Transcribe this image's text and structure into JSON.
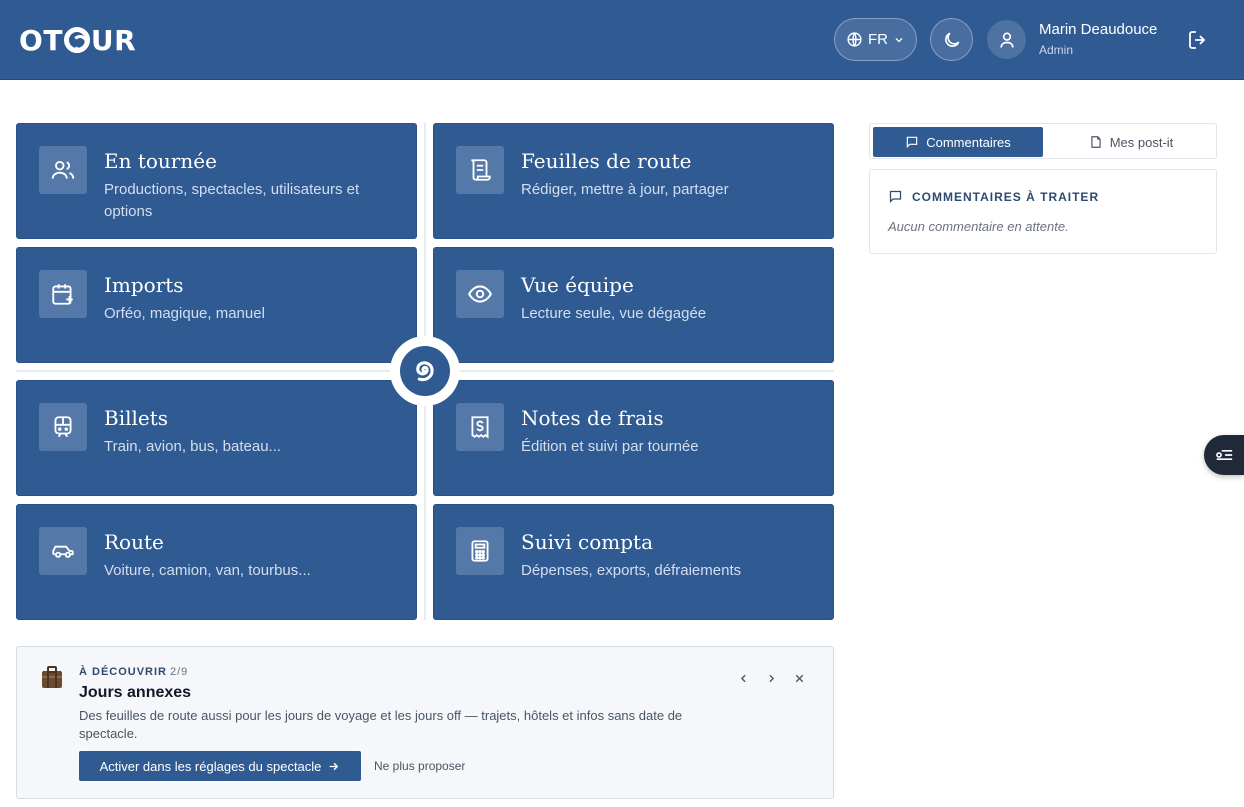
{
  "header": {
    "logo_text": "OTOUR",
    "language": "FR",
    "user": {
      "name": "Marin Deaudouce",
      "role": "Admin"
    }
  },
  "cards": [
    {
      "title": "En tournée",
      "subtitle": "Productions, spectacles, utilisateurs et options",
      "icon": "users-icon"
    },
    {
      "title": "Feuilles de route",
      "subtitle": "Rédiger, mettre à jour, partager",
      "icon": "scroll-icon"
    },
    {
      "title": "Imports",
      "subtitle": "Orféo, magique, manuel",
      "icon": "calendar-plus-icon"
    },
    {
      "title": "Vue équipe",
      "subtitle": "Lecture seule, vue dégagée",
      "icon": "eye-icon"
    },
    {
      "title": "Billets",
      "subtitle": "Train, avion, bus, bateau...",
      "icon": "train-icon"
    },
    {
      "title": "Notes de frais",
      "subtitle": "Édition et suivi par tournée",
      "icon": "receipt-icon"
    },
    {
      "title": "Route",
      "subtitle": "Voiture, camion, van, tourbus...",
      "icon": "car-icon"
    },
    {
      "title": "Suivi compta",
      "subtitle": "Dépenses, exports, défraiements",
      "icon": "calculator-icon"
    }
  ],
  "discover": {
    "kicker": "À DÉCOUVRIR",
    "counter": "2/9",
    "title": "Jours annexes",
    "body": "Des feuilles de route aussi pour les jours de voyage et les jours off — trajets, hôtels et infos sans date de spectacle.",
    "primary_action": "Activer dans les réglages du spectacle",
    "secondary_action": "Ne plus proposer"
  },
  "side": {
    "tabs": [
      {
        "label": "Commentaires",
        "active": true
      },
      {
        "label": "Mes post-it",
        "active": false
      }
    ],
    "comments_heading": "COMMENTAIRES À TRAITER",
    "comments_empty": "Aucun commentaire en attente."
  },
  "colors": {
    "brand": "#2f5a92",
    "card_icon_bg": "#5478a8"
  }
}
